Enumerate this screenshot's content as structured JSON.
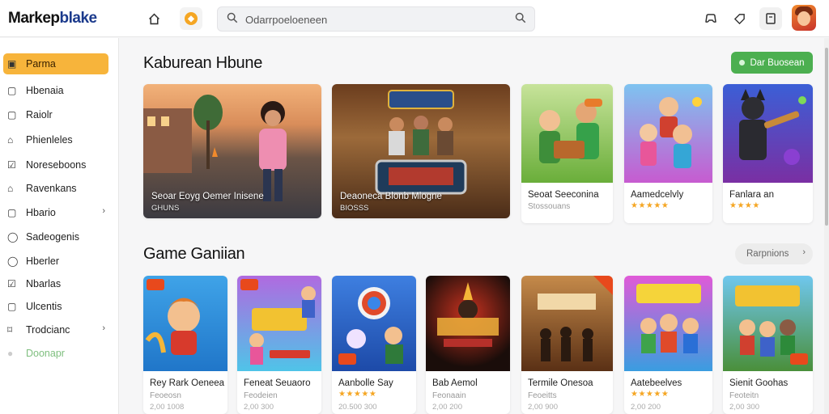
{
  "app": {
    "logo_prefix": "Markep",
    "logo_suffix": "blake"
  },
  "topbar": {
    "search_placeholder": "Odarrpoeloeneen",
    "icons": [
      "home-icon",
      "coin-icon",
      "search-icon",
      "controller-icon",
      "tag-icon",
      "notes-icon"
    ]
  },
  "sidebar": {
    "items": [
      {
        "label": "Parma",
        "icon": "file-icon",
        "active": true
      },
      {
        "label": "Hbenaia",
        "icon": "square-icon"
      },
      {
        "label": "Raiolr",
        "icon": "square-icon"
      },
      {
        "label": "Phienleles",
        "icon": "home-icon"
      },
      {
        "label": "Noreseboons",
        "icon": "check-icon"
      },
      {
        "label": "Ravenkans",
        "icon": "home-icon"
      },
      {
        "label": "Hbario",
        "icon": "square-icon",
        "chevron": ">"
      },
      {
        "label": "Sadeogenis",
        "icon": "circle-icon"
      },
      {
        "label": "Hberler",
        "icon": "circle-icon"
      },
      {
        "label": "Nbarlas",
        "icon": "check-icon"
      },
      {
        "label": "Ulcentis",
        "icon": "square-icon"
      },
      {
        "label": "Trodcianc",
        "icon": "tag-icon",
        "chevron": ">"
      },
      {
        "label": "Doonapr",
        "icon": "circle-icon",
        "muted": true
      }
    ]
  },
  "featured": {
    "title": "Kaburean Hbune",
    "button_label": "Dar Buosean",
    "cards": [
      {
        "title": "Seoar Eoyg Oemer Inisene",
        "sub": "GHUNS"
      },
      {
        "title": "Deaoneca Blonb Mlogne",
        "sub": "BIOSSS"
      },
      {
        "title": "Seoat Seeconina",
        "sub": "Stossouans"
      },
      {
        "title": "Aamedcelvly",
        "stars": "★★★★★"
      },
      {
        "title": "Fanlara  an",
        "stars": "★★★★"
      }
    ]
  },
  "gallery": {
    "title": "Game Ganiian",
    "button_label": "Rarpnions",
    "cards": [
      {
        "title": "Rey Rark Oeneea",
        "sub": "Feoeosn",
        "rating": "2,00 1008"
      },
      {
        "title": "Feneat Seuaoro",
        "sub": "Feodeien",
        "rating": "2,00 300"
      },
      {
        "title": "Aanbolle Say",
        "stars": "★★★★★",
        "rating": "20.500 300"
      },
      {
        "title": "Bab Aemol",
        "sub": "Feonaain",
        "rating": "2,00 200"
      },
      {
        "title": "Termile Onesoa",
        "sub": "Feoeitts",
        "rating": "2,00 900"
      },
      {
        "title": "Aatebeelves",
        "stars": "★★★★★",
        "rating": "2,00 200"
      },
      {
        "title": "Sienit Goohas",
        "sub": "Feoteitn",
        "rating": "2,00 300"
      }
    ]
  },
  "colors": {
    "accent": "#f7b43b",
    "green": "#4caf50",
    "badge": "#e8491c",
    "star": "#f5a623"
  }
}
